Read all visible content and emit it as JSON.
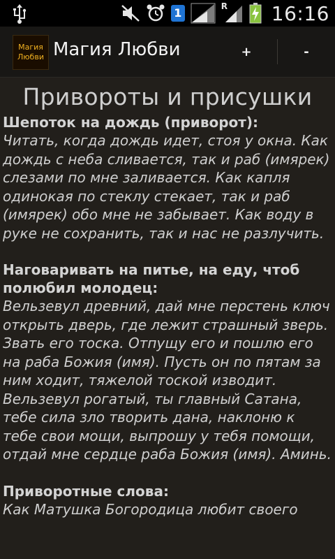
{
  "status_bar": {
    "icons": [
      "usb-icon",
      "mute-icon",
      "alarm-icon",
      "sim-badge",
      "signal-icon",
      "roaming-signal-icon",
      "battery-charging-icon"
    ],
    "sim_badge": "1",
    "roaming_label": "R",
    "time": "16:16"
  },
  "action_bar": {
    "app_icon_line1": "Магия",
    "app_icon_line2": "Любви",
    "title": "Магия Любви",
    "plus_label": "+",
    "minus_label": "-"
  },
  "content": {
    "title": "Привороты и присушки",
    "sections": [
      {
        "heading": "Шепоток на дождь (приворот):",
        "body": "Читать, когда дождь идет, стоя у окна. Как дождь с неба сливается, так и раб (имярек) слезами по мне заливается. Как капля одинокая по стеклу стекает, так и раб (имярек) обо мне не забывает. Как воду в руке не сохранить, так и нас не разлучить."
      },
      {
        "heading": "Наговаривать на питье, на еду, чтоб полюбил молодец:",
        "body": "Вельзевул древний, дай мне перстень ключ открыть дверь, где лежит страшный зверь. Звать его тоска. Отпущу его и пошлю его на раба Божия (имя). Пусть он по пятам за ним ходит, тяжелой тоской изводит. Вельзевул рогатый, ты главный Сатана, тебе сила зло творить дана, наклоню к тебе свои мощи, выпрошу у тебя помощи, отдай мне сердце раба Божия (имя). Аминь."
      },
      {
        "heading": "Приворотные слова:",
        "body": "Как Матушка Богородица любит своего"
      }
    ]
  },
  "colors": {
    "background": "#221f1b",
    "status_bar": "#000000",
    "action_bar": "#181715",
    "sim_badge": "#1f74d4",
    "battery": "#8ac43f",
    "app_icon_text": "#f0b020"
  }
}
